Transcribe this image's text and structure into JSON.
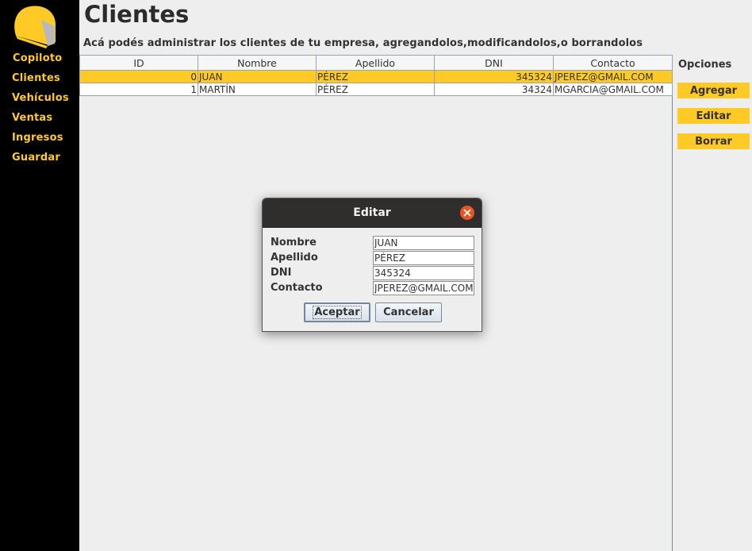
{
  "sidebar": {
    "logo_icon": "helmet-icon",
    "items": [
      {
        "label": "Copiloto"
      },
      {
        "label": "Clientes"
      },
      {
        "label": "Vehículos"
      },
      {
        "label": "Ventas"
      },
      {
        "label": "Ingresos"
      },
      {
        "label": "Guardar"
      }
    ]
  },
  "header": {
    "title": "Clientes",
    "subtitle": "Acá podés administrar los clientes de tu empresa, agregandolos,modificandolos,o borrandolos"
  },
  "table": {
    "columns": [
      "ID",
      "Nombre",
      "Apellido",
      "DNI",
      "Contacto"
    ],
    "rows": [
      {
        "id": "0",
        "nombre": "JUAN",
        "apellido": "PÉREZ",
        "dni": "345324",
        "contacto": "JPEREZ@GMAIL.COM"
      },
      {
        "id": "1",
        "nombre": "MARTÍN",
        "apellido": "PÉREZ",
        "dni": "34324",
        "contacto": "MGARCIA@GMAIL.COM"
      }
    ]
  },
  "options": {
    "title": "Opciones",
    "add_label": "Agregar",
    "edit_label": "Editar",
    "delete_label": "Borrar"
  },
  "dialog": {
    "title": "Editar",
    "fields": [
      {
        "label": "Nombre",
        "value": "JUAN"
      },
      {
        "label": "Apellido",
        "value": "PÉREZ"
      },
      {
        "label": "DNI",
        "value": "345324"
      },
      {
        "label": "Contacto",
        "value": "JPEREZ@GMAIL.COM"
      }
    ],
    "accept_label": "Aceptar",
    "cancel_label": "Cancelar"
  },
  "colors": {
    "accent": "#ffc926",
    "sidebar_bg": "#000000",
    "titlebar_bg": "#2f2e2c",
    "close_button": "#e95420"
  }
}
